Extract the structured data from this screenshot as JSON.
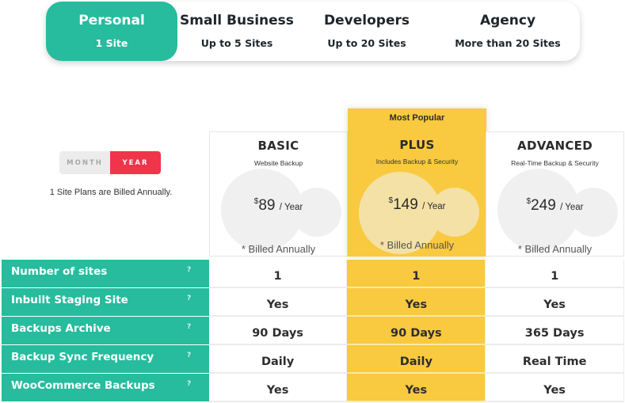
{
  "tabs": [
    {
      "title": "Personal",
      "subtitle": "1 Site",
      "active": true
    },
    {
      "title": "Small Business",
      "subtitle": "Up to 5 Sites",
      "active": false
    },
    {
      "title": "Developers",
      "subtitle": "Up to 20 Sites",
      "active": false
    },
    {
      "title": "Agency",
      "subtitle": "More than 20 Sites",
      "active": false
    }
  ],
  "billing": {
    "month_label": "MONTH",
    "year_label": "YEAR",
    "selected": "YEAR",
    "note": "1 Site Plans are Billed Annually."
  },
  "plans": [
    {
      "name": "BASIC",
      "description": "Website Backup",
      "currency": "$",
      "price": "89",
      "period": "/ Year",
      "billed": "* Billed Annually"
    },
    {
      "badge": "Most Popular",
      "name": "PLUS",
      "description": "Includes Backup & Security",
      "currency": "$",
      "price": "149",
      "period": "/ Year",
      "billed": "* Billed Annually"
    },
    {
      "name": "ADVANCED",
      "description": "Real-Time Backup & Security",
      "currency": "$",
      "price": "249",
      "period": "/ Year",
      "billed": "* Billed Annually"
    }
  ],
  "features": [
    {
      "label": "Number of sites",
      "help": "?",
      "values": [
        "1",
        "1",
        "1"
      ]
    },
    {
      "label": "Inbuilt Staging Site",
      "help": "?",
      "values": [
        "Yes",
        "Yes",
        "Yes"
      ]
    },
    {
      "label": "Backups Archive",
      "help": "?",
      "values": [
        "90 Days",
        "90 Days",
        "365 Days"
      ]
    },
    {
      "label": "Backup Sync Frequency",
      "help": "?",
      "values": [
        "Daily",
        "Daily",
        "Real Time"
      ]
    },
    {
      "label": "WooCommerce Backups",
      "help": "?",
      "values": [
        "Yes",
        "Yes",
        "Yes"
      ]
    }
  ],
  "colors": {
    "accent_green": "#26bc9d",
    "highlight_yellow": "#f9c93f",
    "toggle_red": "#f0344a"
  }
}
